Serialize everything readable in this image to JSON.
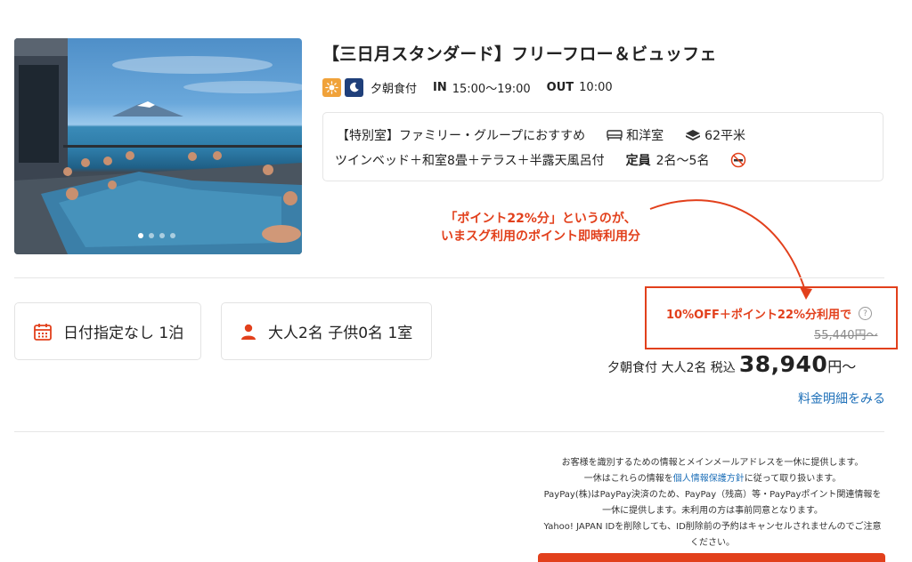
{
  "plan": {
    "title": "【三日月スタンダード】フリーフロー＆ビュッフェ",
    "meal_icons": [
      "sun-icon",
      "moon-icon"
    ],
    "meal_label": "夕朝食付",
    "checkin_label": "IN",
    "checkin_value": "15:00〜19:00",
    "checkout_label": "OUT",
    "checkout_value": "10:00"
  },
  "room": {
    "type": "【特別室】ファミリー・グループにおすすめ",
    "style": "和洋室",
    "size": "62平米",
    "description": "ツインベッド＋和室8畳＋テラス＋半露天風呂付",
    "capacity_label": "定員",
    "capacity_value": "2名〜5名",
    "icons": [
      "bed-icon",
      "area-icon",
      "no-smoking-icon"
    ]
  },
  "gallery": {
    "slide_count": 4,
    "active_slide": 1
  },
  "annotation": {
    "line1": "「ポイント22%分」というのが、",
    "line2": "いまスグ利用のポイント即時利用分",
    "color": "#e2401c"
  },
  "search": {
    "date_label": "日付指定なし 1泊",
    "guests_label": "大人2名 子供0名 1室"
  },
  "price": {
    "discount_label": "10%OFF＋ポイント22%分利用で",
    "original": "55,440円〜",
    "meta": "夕朝食付 大人2名 税込",
    "amount": "38,940",
    "unit": "円〜",
    "detail_link": "料金明細をみる"
  },
  "notice": {
    "line1": "お客様を識別するための情報とメインメールアドレスを一休に提供します。",
    "line2_pre": "一休はこれらの情報を",
    "line2_link": "個人情報保護方針",
    "line2_post": "に従って取り扱います。",
    "line3": "PayPay(株)はPayPay決済のため、PayPay（残高）等・PayPayポイント関連情報を",
    "line4": "一休に提供します。未利用の方は事前同意となります。",
    "line5": "Yahoo! JAPAN IDを削除しても、ID削除前の予約はキャンセルされませんのでご注意",
    "line6": "ください。"
  },
  "colors": {
    "accent_red": "#e2401c",
    "link_blue": "#1d6fb8",
    "sun_badge": "#f0a23a",
    "moon_badge": "#1f3f7a"
  }
}
